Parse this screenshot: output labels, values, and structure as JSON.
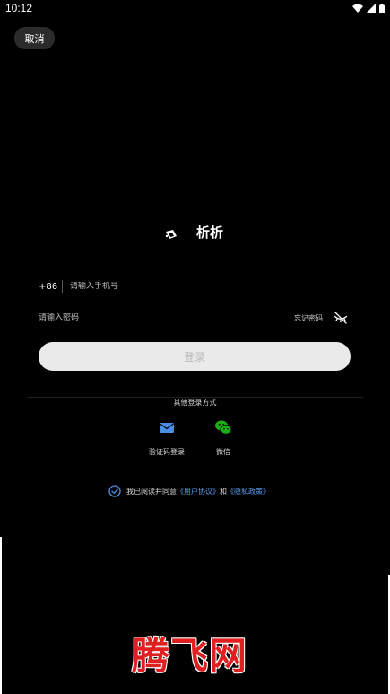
{
  "status_bar": {
    "time": "10:12",
    "icons": [
      "wifi-icon",
      "signal-icon",
      "battery-icon"
    ]
  },
  "header": {
    "cancel_label": "取消"
  },
  "brand": {
    "name": "析析",
    "logo_icon": "app-logo-icon"
  },
  "form": {
    "country_code": "+86",
    "phone_placeholder": "请输入手机号",
    "phone_value": "",
    "password_placeholder": "请输入密码",
    "password_value": "",
    "forgot_label": "忘记密码",
    "eye_icon": "eye-off-icon",
    "login_label": "登录"
  },
  "other_login": {
    "title": "其他登录方式",
    "methods": [
      {
        "label": "验证码登录",
        "icon": "envelope-icon",
        "color": "#4a90e2"
      },
      {
        "label": "微信",
        "icon": "wechat-icon",
        "color": "#1aad19"
      }
    ]
  },
  "agreement": {
    "prefix": "我已阅读并同意",
    "user_agreement": "《用户协议》",
    "conjunction": "和",
    "privacy_policy": "《隐私政策》",
    "checked": true,
    "check_color": "#4a90e2"
  },
  "watermark": {
    "text": "腾飞网",
    "color": "#e02020"
  },
  "colors": {
    "background": "#000000",
    "button_bg": "#eaeaea",
    "button_text": "#b9b9b9",
    "link": "#5b9bf0"
  }
}
